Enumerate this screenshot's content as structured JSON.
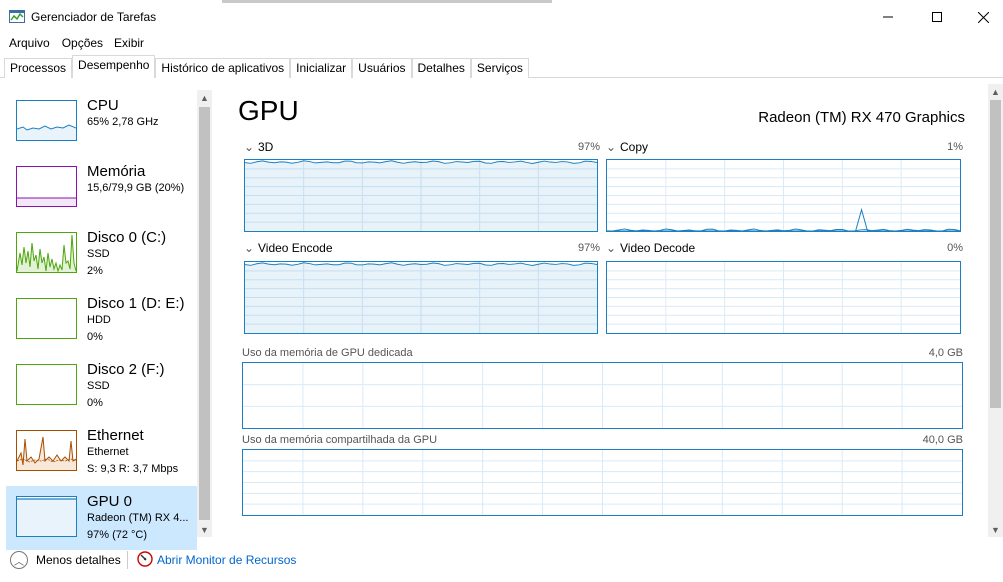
{
  "window": {
    "title": "Gerenciador de Tarefas"
  },
  "menu": [
    "Arquivo",
    "Opções",
    "Exibir"
  ],
  "tabs": [
    {
      "label": "Processos",
      "active": false
    },
    {
      "label": "Desempenho",
      "active": true
    },
    {
      "label": "Histórico de aplicativos",
      "active": false
    },
    {
      "label": "Inicializar",
      "active": false
    },
    {
      "label": "Usuários",
      "active": false
    },
    {
      "label": "Detalhes",
      "active": false
    },
    {
      "label": "Serviços",
      "active": false
    }
  ],
  "sidebar": [
    {
      "name": "CPU",
      "line2": "65% 2,78 GHz",
      "line3": "",
      "color": "#1b7fc2",
      "selected": false
    },
    {
      "name": "Memória",
      "line2": "15,6/79,9 GB (20%)",
      "line3": "",
      "color": "#8b12ae",
      "selected": false
    },
    {
      "name": "Disco 0 (C:)",
      "line2": "SSD",
      "line3": "2%",
      "color": "#4da60c",
      "selected": false
    },
    {
      "name": "Disco 1 (D: E:)",
      "line2": "HDD",
      "line3": "0%",
      "color": "#4da60c",
      "selected": false
    },
    {
      "name": "Disco 2 (F:)",
      "line2": "SSD",
      "line3": "0%",
      "color": "#4da60c",
      "selected": false
    },
    {
      "name": "Ethernet",
      "line2": "Ethernet",
      "line3": "S: 9,3 R: 3,7 Mbps",
      "color": "#a74f01",
      "selected": false
    },
    {
      "name": "GPU 0",
      "line2": "Radeon (TM) RX 4...",
      "line3": "97% (72 °C)",
      "color": "#1b7fc2",
      "selected": true
    }
  ],
  "gpu": {
    "title": "GPU",
    "model": "Radeon (TM) RX 470 Graphics",
    "engines": [
      {
        "label": "3D",
        "percent": "97%",
        "level": 0.97
      },
      {
        "label": "Copy",
        "percent": "1%",
        "level": 0.01
      },
      {
        "label": "Video Encode",
        "percent": "97%",
        "level": 0.97
      },
      {
        "label": "Video Decode",
        "percent": "0%",
        "level": 0.0
      }
    ],
    "dedicated": {
      "label": "Uso da memória de GPU dedicada",
      "value": "4,0 GB"
    },
    "shared": {
      "label": "Uso da memória compartilhada da GPU",
      "value": "40,0 GB"
    }
  },
  "footer": {
    "less_details": "Menos detalhes",
    "resource_monitor": "Abrir Monitor de Recursos"
  }
}
